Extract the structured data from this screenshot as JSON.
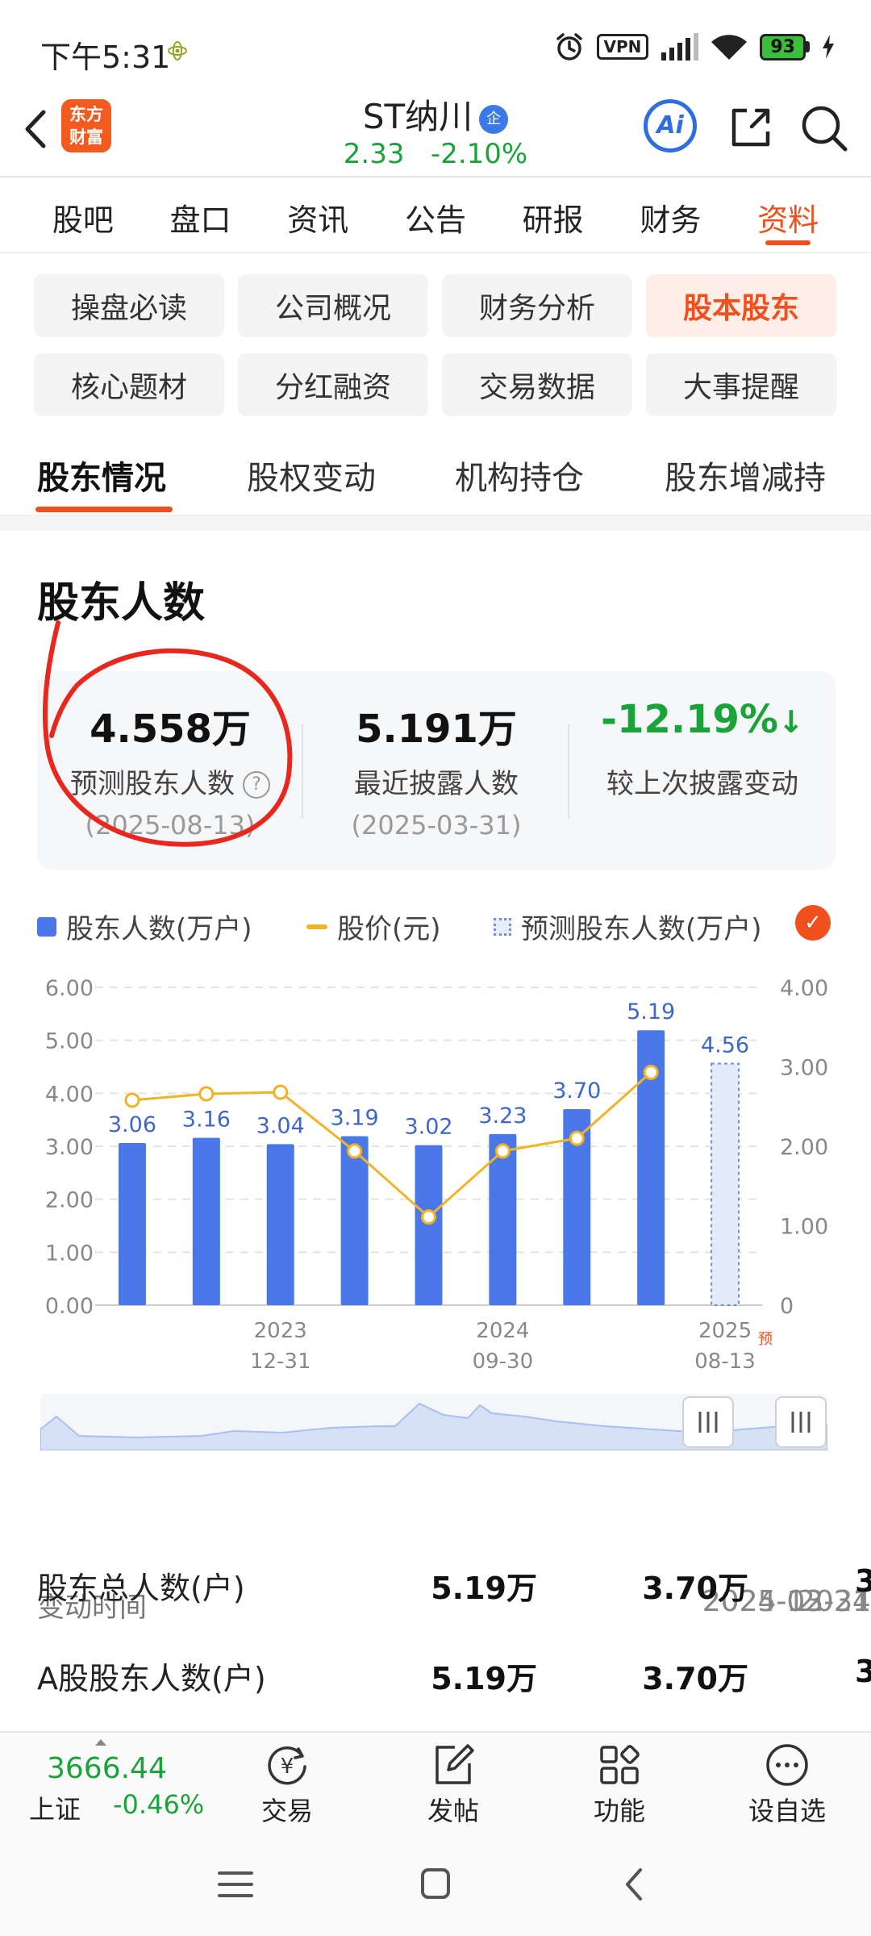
{
  "status_bar": {
    "time": "下午5:31",
    "vpn": "VPN",
    "battery": "93"
  },
  "header": {
    "logo_line1": "东方",
    "logo_line2": "财富",
    "stock_name": "ST纳川",
    "badge": "企",
    "price": "2.33",
    "change": "-2.10%",
    "ai_label": "Ai"
  },
  "main_tabs": [
    {
      "label": "股吧"
    },
    {
      "label": "盘口"
    },
    {
      "label": "资讯"
    },
    {
      "label": "公告"
    },
    {
      "label": "研报"
    },
    {
      "label": "财务"
    },
    {
      "label": "资料",
      "active": true
    }
  ],
  "chips": [
    {
      "label": "操盘必读"
    },
    {
      "label": "公司概况"
    },
    {
      "label": "财务分析"
    },
    {
      "label": "股本股东",
      "active": true
    },
    {
      "label": "核心题材"
    },
    {
      "label": "分红融资"
    },
    {
      "label": "交易数据"
    },
    {
      "label": "大事提醒"
    }
  ],
  "sub_tabs": [
    {
      "label": "股东情况",
      "active": true
    },
    {
      "label": "股权变动"
    },
    {
      "label": "机构持仓"
    },
    {
      "label": "股东增减持"
    }
  ],
  "section": {
    "title": "股东人数",
    "summary": [
      {
        "value": "4.558万",
        "label": "预测股东人数",
        "date": "(2025-08-13)"
      },
      {
        "value": "5.191万",
        "label": "最近披露人数",
        "date": "(2025-03-31)"
      },
      {
        "value": "-12.19%",
        "label": "较上次披露变动",
        "arrow": "↓"
      }
    ]
  },
  "legend": {
    "bars": "股东人数(万户)",
    "line": "股价(元)",
    "forecast": "预测股东人数(万户)",
    "check": "✓"
  },
  "chart_data": {
    "type": "bar",
    "categories": [
      "c1",
      "c2",
      "2023-12-31",
      "c4",
      "c5",
      "2024-09-30",
      "c7",
      "c8",
      "2025-08-13"
    ],
    "x_tick_labels": [
      {
        "index": 2,
        "line1": "2023",
        "line2": "12-31"
      },
      {
        "index": 5,
        "line1": "2024",
        "line2": "09-30"
      },
      {
        "index": 8,
        "line1": "2025",
        "line2": "08-13",
        "tag": "预"
      }
    ],
    "series": [
      {
        "name": "股东人数(万户)",
        "type": "bar",
        "axis": "left",
        "color": "#4a78e8",
        "values": [
          3.06,
          3.16,
          3.04,
          3.19,
          3.02,
          3.23,
          3.7,
          5.19,
          null
        ],
        "labels": [
          "3.06",
          "3.16",
          "3.04",
          "3.19",
          "3.02",
          "3.23",
          "3.70",
          "5.19",
          ""
        ]
      },
      {
        "name": "预测股东人数(万户)",
        "type": "bar",
        "axis": "left",
        "color": "#6d8fe0",
        "style": "dashed",
        "values": [
          null,
          null,
          null,
          null,
          null,
          null,
          null,
          null,
          4.56
        ],
        "labels": [
          "",
          "",
          "",
          "",
          "",
          "",
          "",
          "",
          "4.56"
        ]
      },
      {
        "name": "股价(元)",
        "type": "line",
        "axis": "right",
        "color": "#f0b429",
        "values": [
          2.58,
          2.66,
          2.68,
          1.94,
          1.11,
          1.94,
          2.1,
          2.93,
          null
        ]
      }
    ],
    "left_axis": {
      "min": 0,
      "max": 6,
      "ticks": [
        "0.00",
        "1.00",
        "2.00",
        "3.00",
        "4.00",
        "5.00",
        "6.00"
      ]
    },
    "right_axis": {
      "min": 0,
      "max": 4,
      "ticks": [
        "0",
        "1.00",
        "2.00",
        "3.00",
        "4.00"
      ]
    },
    "grid": true
  },
  "table": {
    "header_label": "变动时间",
    "dates": [
      "2025-03-31",
      "2024-12-31",
      "2024-"
    ],
    "rows": [
      {
        "label": "股东总人数(户)",
        "values": [
          "5.19万",
          "3.70万",
          "3"
        ]
      },
      {
        "label": "A股股东人数(户)",
        "values": [
          "5.19万",
          "3.70万",
          "3"
        ]
      }
    ]
  },
  "bottom_bar": {
    "index_value": "3666.44",
    "index_name": "上证",
    "index_change": "-0.46%",
    "items": [
      {
        "label": "交易",
        "icon": "trade-icon"
      },
      {
        "label": "发帖",
        "icon": "post-icon"
      },
      {
        "label": "功能",
        "icon": "function-icon"
      },
      {
        "label": "设自选",
        "icon": "more-icon"
      }
    ]
  }
}
